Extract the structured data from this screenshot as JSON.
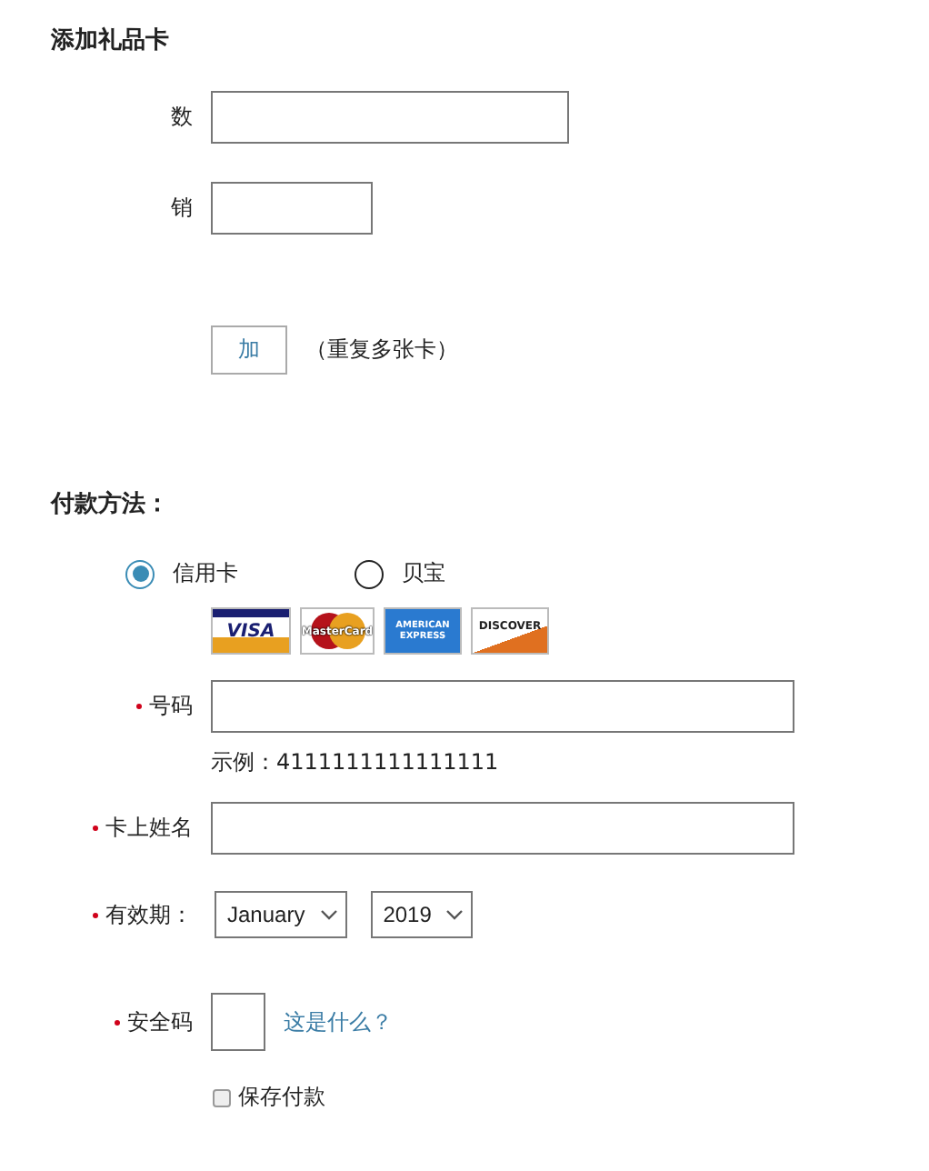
{
  "gift_card": {
    "title": "添加礼品卡",
    "fields": [
      {
        "label": "数",
        "kind": "wide"
      },
      {
        "label": "销",
        "kind": "short"
      }
    ],
    "add_button": "加",
    "add_note": "（重复多张卡）"
  },
  "payment": {
    "title": "付款方法：",
    "methods": [
      {
        "label": "信用卡",
        "selected": true
      },
      {
        "label": "贝宝",
        "selected": false
      }
    ],
    "cards": [
      {
        "kind": "visa",
        "label": "VISA"
      },
      {
        "kind": "mastercard",
        "label": "MasterCard"
      },
      {
        "kind": "amex",
        "label": "AMERICAN EXPRESS"
      },
      {
        "kind": "discover",
        "label": "DISCOVER"
      }
    ],
    "card_number": {
      "label": "号码",
      "required": true,
      "hint": "示例：4111111111111111"
    },
    "name_on_card": {
      "label": "卡上姓名",
      "required": true
    },
    "expiry": {
      "label": "有效期：",
      "required": true,
      "month": "January",
      "year": "2019"
    },
    "security_code": {
      "label": "安全码",
      "required": true,
      "help_link": "这是什么？"
    },
    "save_payment": {
      "label": "保存付款",
      "checked": false
    }
  }
}
